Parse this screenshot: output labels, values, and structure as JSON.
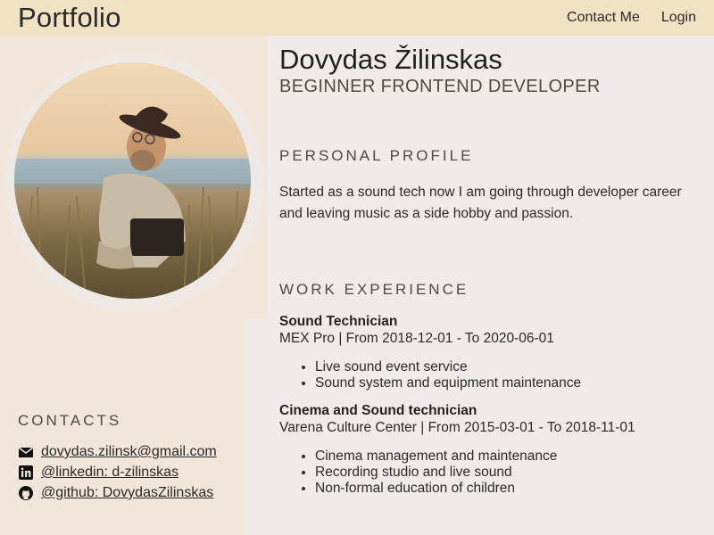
{
  "header": {
    "brand": "Portfolio",
    "nav": [
      "Contact Me",
      "Login"
    ]
  },
  "profile": {
    "name": "Dovydas Žilinskas",
    "role": "BEGINNER FRONTEND DEVELOPER",
    "photo_icon": "portrait-photo"
  },
  "contacts": {
    "heading": "CONTACTS",
    "items": [
      {
        "icon": "mail-icon",
        "text": "dovydas.zilinsk@gmail.com"
      },
      {
        "icon": "linkedin-icon",
        "text": "@linkedin: d-zilinskas"
      },
      {
        "icon": "github-icon",
        "text": "@github: DovydasZilinskas"
      }
    ]
  },
  "personal_profile": {
    "heading": "PERSONAL PROFILE",
    "text": "Started as a sound tech now I am going through developer career and leaving music as a side hobby and passion."
  },
  "work_experience": {
    "heading": "WORK EXPERIENCE",
    "jobs": [
      {
        "title": "Sound Technician",
        "meta": "MEX Pro | From 2018-12-01 - To 2020-06-01",
        "duties": [
          "Live sound event service",
          "Sound system and equipment maintenance"
        ]
      },
      {
        "title": "Cinema and Sound technician",
        "meta": "Varena Culture Center | From 2015-03-01 - To 2018-11-01",
        "duties": [
          "Cinema management and maintenance",
          "Recording studio and live sound",
          "Non-formal education of children"
        ]
      }
    ]
  },
  "colors": {
    "topbar": "#f2e2c4",
    "sidebar": "#f2e6da",
    "page": "#f0ebe8"
  }
}
